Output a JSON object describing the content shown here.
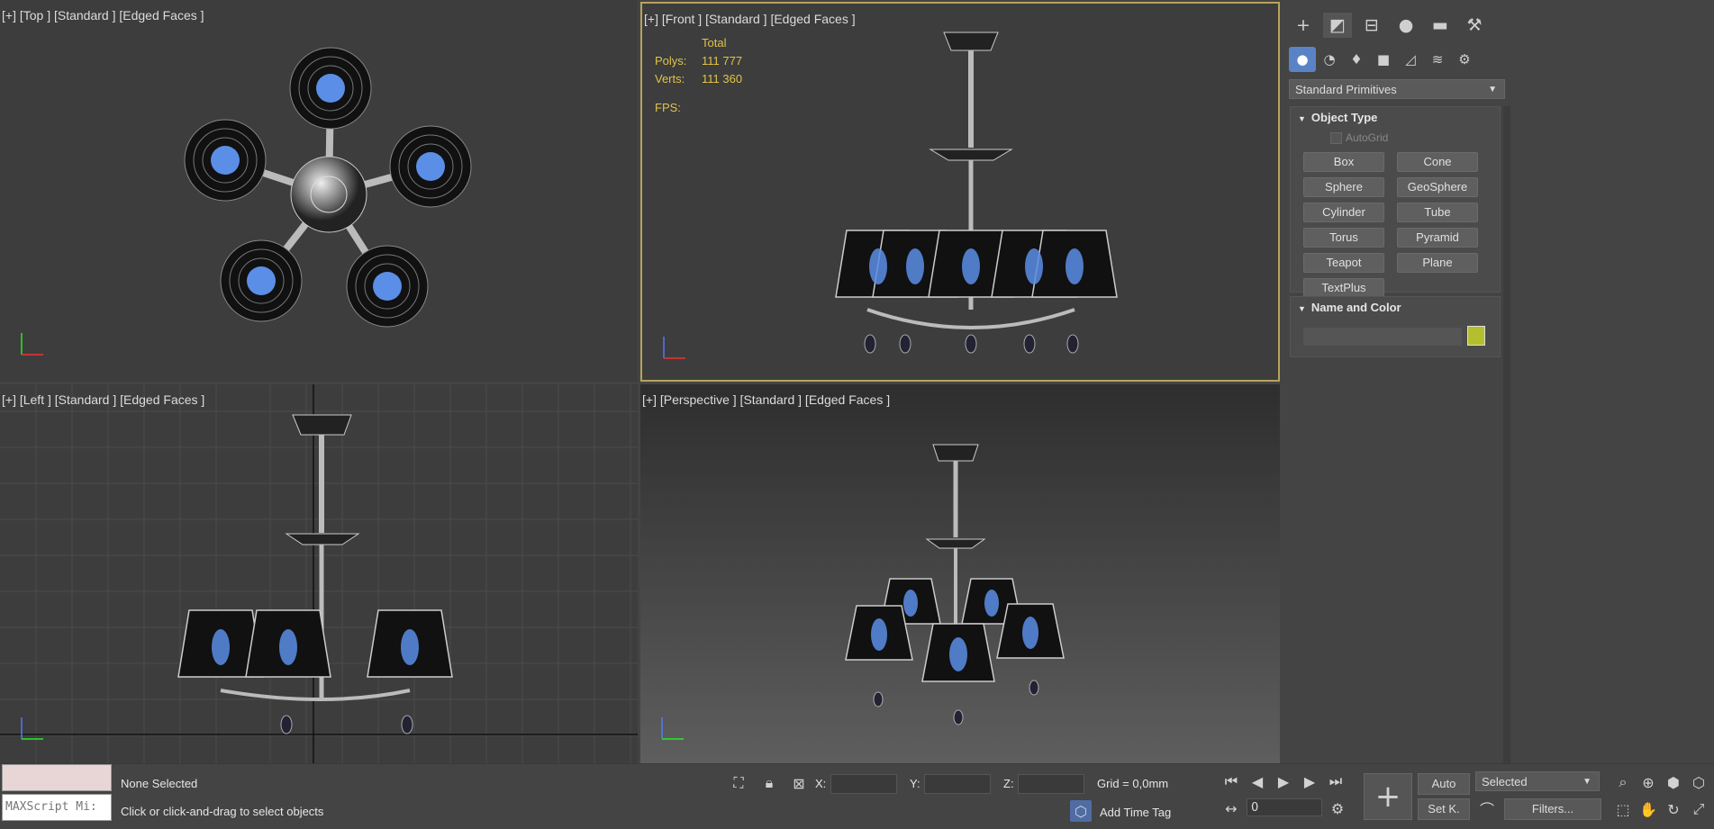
{
  "viewports": {
    "top": {
      "label": "[+] [Top ] [Standard ] [Edged Faces ]"
    },
    "front": {
      "label": "[+] [Front ] [Standard ] [Edged Faces ]"
    },
    "left": {
      "label": "[+] [Left ] [Standard ] [Edged Faces ]"
    },
    "perspective": {
      "label": "[+] [Perspective ] [Standard ] [Edged Faces ]"
    }
  },
  "stats": {
    "header": "Total",
    "polys_label": "Polys:",
    "polys_value": "111 777",
    "verts_label": "Verts:",
    "verts_value": "111 360",
    "fps_label": "FPS:"
  },
  "command_panel": {
    "tabs": [
      "create-icon",
      "modify-icon",
      "hierarchy-icon",
      "motion-icon",
      "display-icon",
      "utilities-icon"
    ],
    "subtabs": [
      "geometry-icon",
      "shapes-icon",
      "lights-icon",
      "cameras-icon",
      "helpers-icon",
      "spacewarps-icon",
      "systems-icon"
    ],
    "category": "Standard Primitives",
    "object_type": {
      "title": "Object Type",
      "autogrid": "AutoGrid",
      "buttons": [
        "Box",
        "Cone",
        "Sphere",
        "GeoSphere",
        "Cylinder",
        "Tube",
        "Torus",
        "Pyramid",
        "Teapot",
        "Plane",
        "TextPlus"
      ]
    },
    "name_color": {
      "title": "Name and Color",
      "name_value": "",
      "color": "#b3bf2e"
    }
  },
  "status": {
    "maxscript": "MAXScript Mi:",
    "selection": "None Selected",
    "prompt": "Click or click-and-drag to select objects",
    "x_label": "X:",
    "y_label": "Y:",
    "z_label": "Z:",
    "grid": "Grid = 0,0mm",
    "add_time_tag": "Add Time Tag",
    "frame": "0",
    "auto": "Auto",
    "set_key": "Set K.",
    "selected": "Selected",
    "filters": "Filters..."
  }
}
